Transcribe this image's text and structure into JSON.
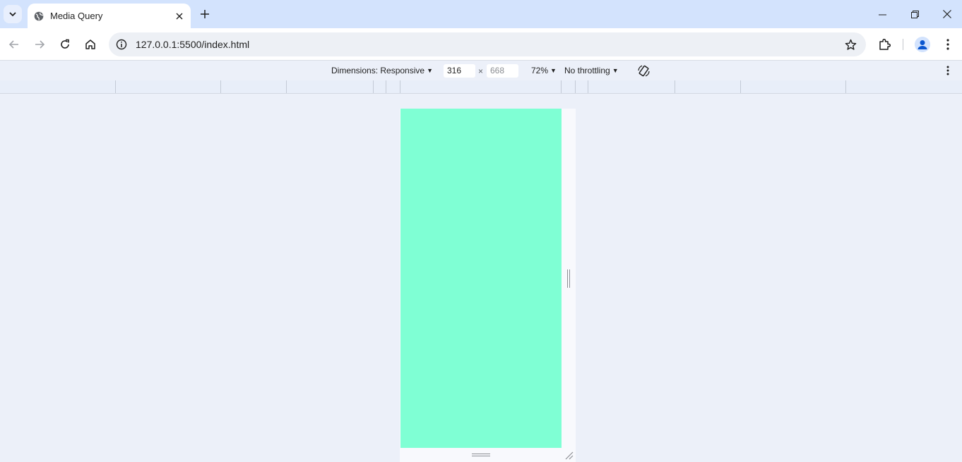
{
  "tab": {
    "title": "Media Query"
  },
  "toolbar": {
    "url": "127.0.0.1:5500/index.html"
  },
  "device_toolbar": {
    "dimensions_label": "Dimensions: Responsive",
    "width_value": "316",
    "height_placeholder": "668",
    "times_sign": "×",
    "zoom": "72%",
    "throttling": "No throttling"
  },
  "viewport": {
    "background_color": "#7fffd4"
  },
  "colors": {
    "tabstrip": "#d3e3fd",
    "page_background": "#ecf0f9"
  },
  "icons": [
    "tab-search-icon",
    "globe-icon",
    "close-icon",
    "plus-icon",
    "minimize-icon",
    "restore-icon",
    "window-close-icon",
    "back-arrow-icon",
    "forward-arrow-icon",
    "reload-icon",
    "home-icon",
    "info-icon",
    "star-icon",
    "extensions-icon",
    "profile-icon",
    "kebab-menu-icon",
    "rotate-icon"
  ]
}
